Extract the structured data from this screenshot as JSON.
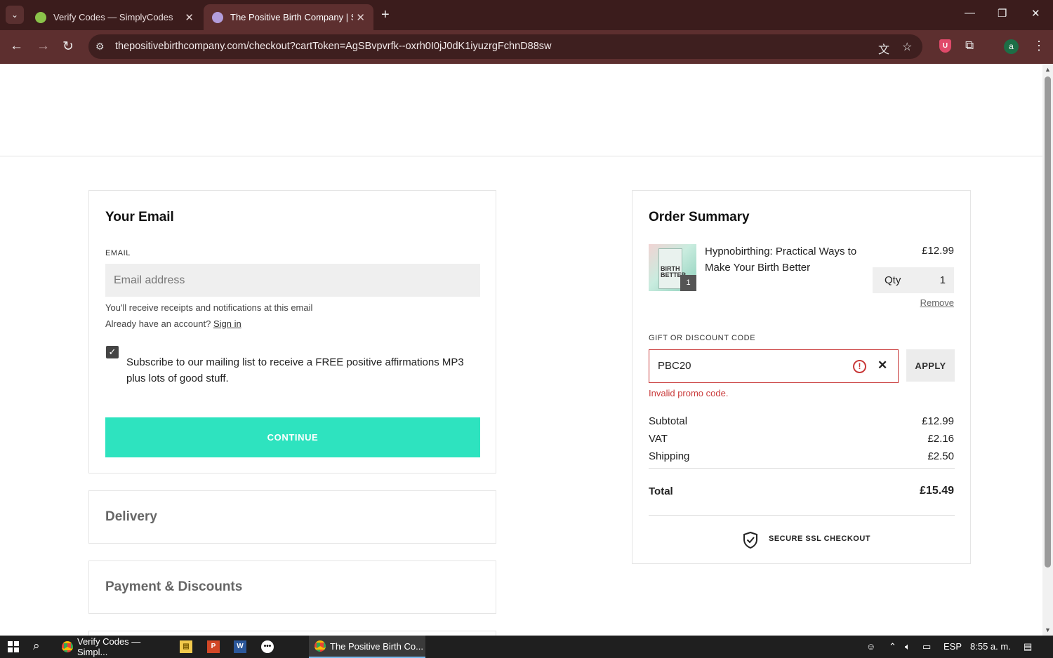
{
  "browser": {
    "tabs": [
      {
        "title": "Verify Codes — SimplyCodes",
        "active": false
      },
      {
        "title": "The Positive Birth Company | Se",
        "active": true
      }
    ],
    "url": "thepositivebirthcompany.com/checkout?cartToken=AgSBvpvrfk--oxrh0I0jJ0dK1iyuzrgFchnD88sw",
    "profile_initial": "a",
    "ublock_label": "U"
  },
  "email_section": {
    "title": "Your Email",
    "email_label": "EMAIL",
    "email_placeholder": "Email address",
    "email_value": "",
    "hint_receipts": "You'll receive receipts and notifications at this email",
    "hint_account": "Already have an account?",
    "sign_in": "Sign in",
    "subscribe_checked": true,
    "subscribe_text": "Subscribe to our mailing list to receive a FREE positive affirmations MP3 plus lots of good stuff.",
    "continue_label": "CONTINUE"
  },
  "delivery_section": {
    "title": "Delivery"
  },
  "payment_section": {
    "title": "Payment & Discounts"
  },
  "order_summary": {
    "title": "Order Summary",
    "item": {
      "name": "Hypnobirthing: Practical Ways to Make Your Birth Better",
      "price": "£12.99",
      "qty_label": "Qty",
      "qty": "1",
      "badge": "1",
      "remove": "Remove",
      "cover_text": "BIRTH BETTER"
    },
    "discount_label": "GIFT OR DISCOUNT CODE",
    "discount_value": "PBC20",
    "apply_label": "APPLY",
    "error": "Invalid promo code.",
    "subtotal_label": "Subtotal",
    "subtotal": "£12.99",
    "vat_label": "VAT",
    "vat": "£2.16",
    "shipping_label": "Shipping",
    "shipping": "£2.50",
    "total_label": "Total",
    "total": "£15.49",
    "ssl_label": "SECURE SSL CHECKOUT"
  },
  "taskbar": {
    "apps": [
      {
        "label": "Verify Codes — Simpl...",
        "active": false
      },
      {
        "label": "The Positive Birth Co...",
        "active": true
      }
    ],
    "language": "ESP",
    "time": "8:55 a. m."
  },
  "colors": {
    "continue_button": "#2ee3bf",
    "error": "#c93a3a",
    "browser_frame": "#5d2f2f",
    "tab_strip": "#3b1c1c"
  }
}
